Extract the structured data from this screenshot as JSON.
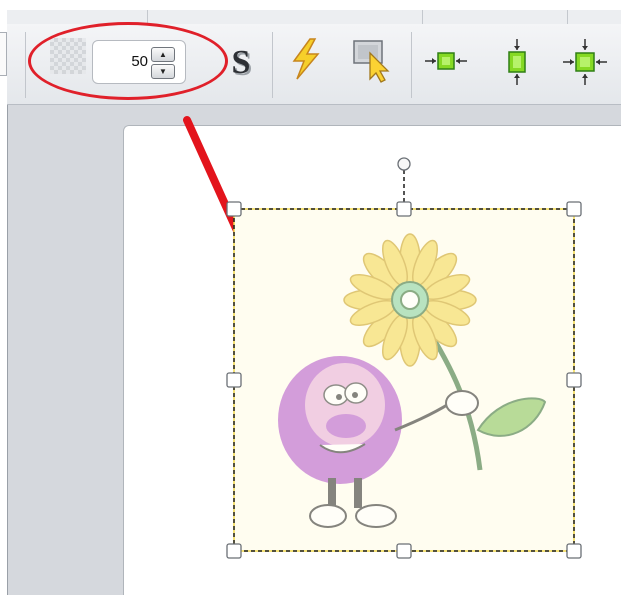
{
  "toolbar": {
    "transparency_value": "50",
    "spin_up_symbol": "▲",
    "spin_down_symbol": "▼",
    "tools": [
      {
        "name": "shadow-s-icon",
        "glyph": "S"
      },
      {
        "name": "lightning-icon"
      },
      {
        "name": "select-pointer-icon"
      },
      {
        "name": "align-horizontal-center-icon"
      },
      {
        "name": "align-vertical-center-icon"
      },
      {
        "name": "align-both-center-icon"
      }
    ]
  },
  "colors": {
    "highlight": "#e0202a",
    "selection_border": "#000000",
    "selection_fill": "#fffce0",
    "handle": "#ffffff",
    "icon_green": "#7ed321"
  },
  "canvas": {
    "image": "clipart-sunflower-character",
    "image_opacity_percent": 50
  }
}
